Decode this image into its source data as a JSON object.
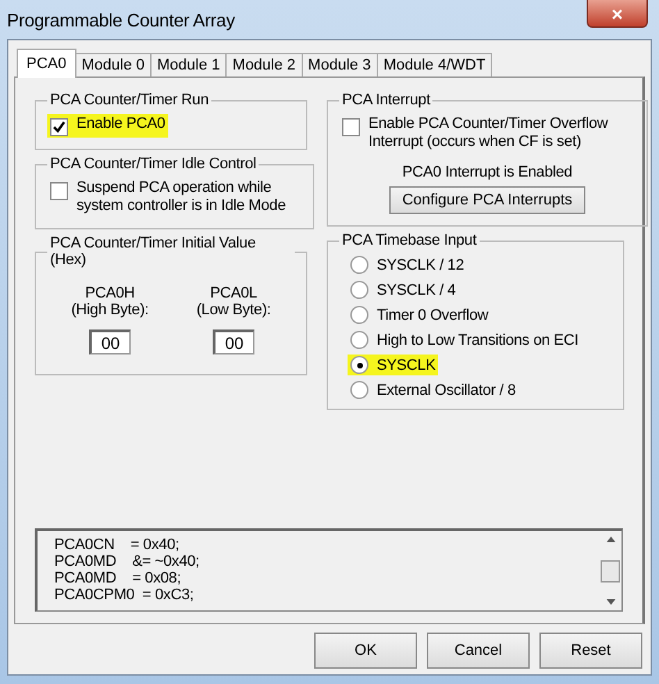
{
  "window": {
    "title": "Programmable Counter Array",
    "close": "×"
  },
  "tabs": [
    {
      "label": "PCA0",
      "selected": true
    },
    {
      "label": "Module 0",
      "selected": false
    },
    {
      "label": "Module 1",
      "selected": false
    },
    {
      "label": "Module 2",
      "selected": false
    },
    {
      "label": "Module 3",
      "selected": false
    },
    {
      "label": "Module 4/WDT",
      "selected": false
    }
  ],
  "run_group": {
    "title": "PCA Counter/Timer Run",
    "checkbox": {
      "label": "Enable PCA0",
      "checked": true,
      "highlighted": true
    }
  },
  "idle_group": {
    "title": "PCA Counter/Timer Idle Control",
    "checkbox": {
      "label": "Suspend PCA operation while system controller is in Idle Mode",
      "checked": false,
      "highlighted": false
    }
  },
  "initial_group": {
    "title": "PCA Counter/Timer Initial Value (Hex)",
    "fields": [
      {
        "label": "PCA0H",
        "sublabel": "(High Byte):",
        "value": "00"
      },
      {
        "label": "PCA0L",
        "sublabel": "(Low Byte):",
        "value": "00"
      }
    ]
  },
  "interrupt_group": {
    "title": "PCA Interrupt",
    "checkbox": {
      "label": "Enable PCA Counter/Timer Overflow Interrupt (occurs when CF is set)",
      "checked": false,
      "highlighted": false
    },
    "status": "PCA0 Interrupt is Enabled",
    "button": "Configure PCA Interrupts"
  },
  "timebase_group": {
    "title": "PCA Timebase Input",
    "options": [
      {
        "label": "SYSCLK / 12",
        "selected": false,
        "highlighted": false
      },
      {
        "label": "SYSCLK / 4",
        "selected": false,
        "highlighted": false
      },
      {
        "label": "Timer 0 Overflow",
        "selected": false,
        "highlighted": false
      },
      {
        "label": "High to Low Transitions on ECI",
        "selected": false,
        "highlighted": false
      },
      {
        "label": "SYSCLK",
        "selected": true,
        "highlighted": true
      },
      {
        "label": "External Oscillator / 8",
        "selected": false,
        "highlighted": false
      }
    ]
  },
  "code_lines": [
    "PCA0CN    = 0x40;",
    "PCA0MD    &= ~0x40;",
    "PCA0MD    = 0x08;",
    "PCA0CPM0  = 0xC3;"
  ],
  "buttons": [
    "OK",
    "Cancel",
    "Reset"
  ]
}
